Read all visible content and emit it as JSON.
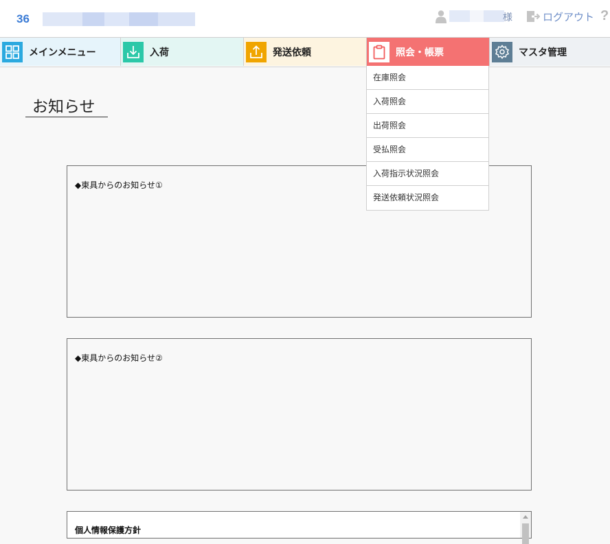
{
  "header": {
    "company_code": "36",
    "user_suffix": "様",
    "logout_label": "ログアウト",
    "help_label": "?"
  },
  "nav": {
    "items": [
      {
        "label": "メインメニュー",
        "icon": "grid-icon",
        "color": "#2ba9df"
      },
      {
        "label": "入荷",
        "icon": "download-icon",
        "color": "#2cc8a8"
      },
      {
        "label": "発送依頼",
        "icon": "upload-icon",
        "color": "#f0a500"
      },
      {
        "label": "照会・帳票",
        "icon": "clipboard-icon",
        "color": "#f25a5a"
      },
      {
        "label": "マスタ管理",
        "icon": "gear-icon",
        "color": "#5e7e95"
      }
    ],
    "active_index": 3
  },
  "dropdown": {
    "items": [
      "在庫照会",
      "入荷照会",
      "出荷照会",
      "受払照会",
      "入荷指示状況照会",
      "発送依頼状況照会"
    ]
  },
  "page": {
    "title": "お知らせ",
    "notices": [
      {
        "title": "◆東具からのお知らせ①"
      },
      {
        "title": "◆東具からのお知らせ②"
      }
    ],
    "privacy_title": "個人情報保護方針"
  },
  "colors": {
    "accent_blue": "#3a7bd5",
    "nav_menu_bg": "#e6f4fb",
    "nav_receive_bg": "#e3f6f3",
    "nav_ship_bg": "#fdf4e0",
    "nav_inquiry_bg": "#f47272",
    "nav_master_bg": "#eef1f4"
  }
}
